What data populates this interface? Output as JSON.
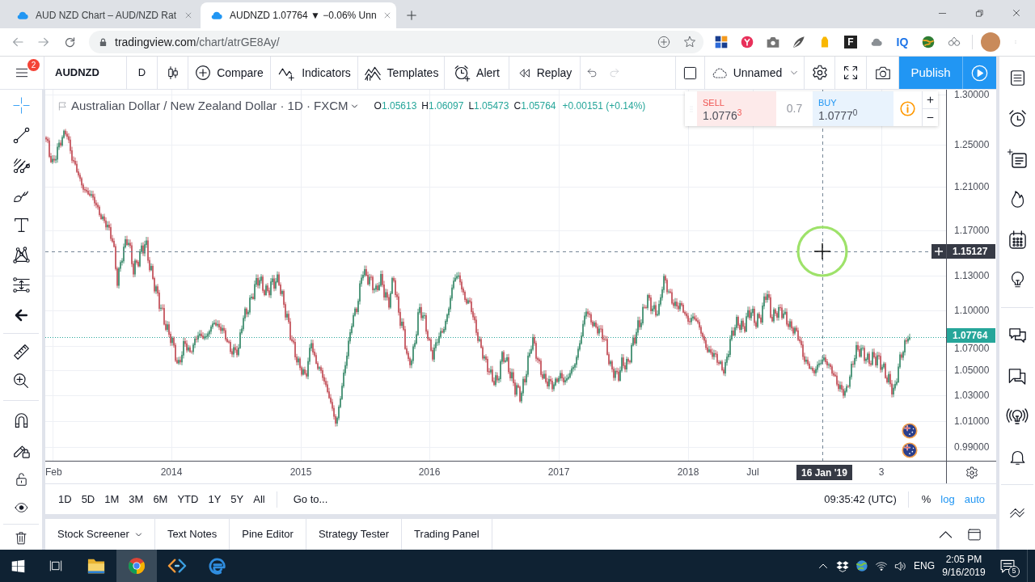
{
  "browser": {
    "tabs": [
      {
        "title": "AUD NZD Chart – AUD/NZD Rat",
        "selected": false
      },
      {
        "title": "AUDNZD 1.07764 ▼ −0.06% Unn",
        "selected": true
      }
    ],
    "url": {
      "host": "tradingview.com",
      "path": "/chart/atrGE8Ay/"
    },
    "extension_labels": [
      "F",
      "IQ"
    ]
  },
  "toolbar": {
    "menu_badge": "2",
    "symbol": "AUDNZD",
    "interval": "D",
    "buttons": [
      "Compare",
      "Indicators",
      "Templates",
      "Alert",
      "Replay"
    ],
    "history": [
      {
        "disabled": false
      },
      {
        "disabled": true
      }
    ],
    "layout_name": "Unnamed",
    "publish": "Publish"
  },
  "drawing_tools": [
    {
      "selected": true
    },
    {
      "selected": false
    },
    {
      "selected": false
    },
    {
      "selected": false
    },
    {
      "selected": false
    },
    {
      "selected": false
    },
    {
      "selected": false
    }
  ],
  "chart": {
    "title": "Australian Dollar / New Zealand Dollar · 1D · FXCM",
    "ohlc": [
      {
        "label": "O",
        "value": "1.05613"
      },
      {
        "label": "H",
        "value": "1.06097"
      },
      {
        "label": "L",
        "value": "1.05473"
      },
      {
        "label": "C",
        "value": "1.05764"
      }
    ],
    "change": "+0.00151 (+0.14%)",
    "trade": {
      "sell_label": "SELL",
      "sell_price": "1.0776$^{3}$",
      "spread": "0.7",
      "buy_label": "BUY",
      "buy_price": "1.0777$^{0}$"
    },
    "price_ticks": [
      "1.30000",
      "1.25000",
      "1.21000",
      "1.17000",
      "1.13000",
      "1.10000",
      "1.07000",
      "1.05000",
      "1.03000",
      "1.01000",
      "0.99000"
    ],
    "last_price": "1.07764",
    "crosshair_price": "1.15127",
    "time_ticks": [
      "Feb",
      "2014",
      "2015",
      "2016",
      "2017",
      "2018",
      "Jul",
      "3"
    ],
    "crosshair_time": "16 Jan '19"
  },
  "range_bar": {
    "ranges": [
      "1D",
      "5D",
      "1M",
      "3M",
      "6M",
      "YTD",
      "1Y",
      "5Y",
      "All"
    ],
    "goto": "Go to...",
    "clock": "09:35:42 (UTC)",
    "scale_options": [
      {
        "label": "%",
        "on": false
      },
      {
        "label": "log",
        "on": true
      },
      {
        "label": "auto",
        "on": true
      }
    ]
  },
  "bottom_tabs": [
    {
      "label": "Stock Screener",
      "dropdown": true
    },
    {
      "label": "Text Notes",
      "dropdown": false
    },
    {
      "label": "Pine Editor",
      "dropdown": false
    },
    {
      "label": "Strategy Tester",
      "dropdown": false
    },
    {
      "label": "Trading Panel",
      "dropdown": false
    }
  ],
  "taskbar": {
    "apps": [
      {
        "selected": false
      },
      {
        "selected": true
      },
      {
        "selected": false
      },
      {
        "selected": false
      }
    ],
    "language": "ENG",
    "time": "2:05 PM",
    "date": "9/16/2019",
    "notifications": "5"
  }
}
